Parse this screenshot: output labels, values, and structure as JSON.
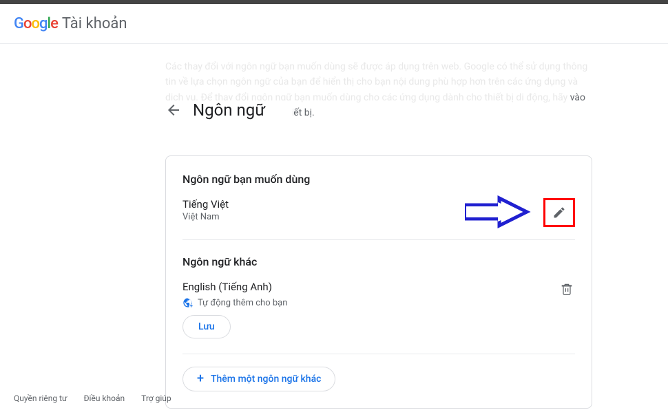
{
  "header": {
    "account_label": "Tài khoản"
  },
  "faded_description": "Các thay đổi với ngôn ngữ bạn muốn dùng sẽ được áp dụng trên web. Google có thể sử dụng thông tin về lựa chọn ngôn ngữ của bạn để hiển thị cho bạn nội dung phù hợp hơn trên các ứng dụng và dịch vụ. Để thay đổi ngôn ngữ bạn muốn dùng cho các ứng dụng dành cho thiết bị di động, hãy ",
  "faded_tail": "vào phần cài đặt ngôn ngữ trên thiết bị.",
  "page_title": "Ngôn ngữ",
  "card": {
    "preferred_title": "Ngôn ngữ bạn muốn dùng",
    "preferred_lang": "Tiếng Việt",
    "preferred_region": "Việt Nam",
    "other_title": "Ngôn ngữ khác",
    "other_lang": "English (Tiếng Anh)",
    "auto_added": "Tự động thêm cho bạn",
    "save_label": "Lưu",
    "add_label": "Thêm một ngôn ngữ khác"
  },
  "footer": {
    "privacy": "Quyền riêng tư",
    "terms": "Điều khoản",
    "help": "Trợ giúp"
  }
}
